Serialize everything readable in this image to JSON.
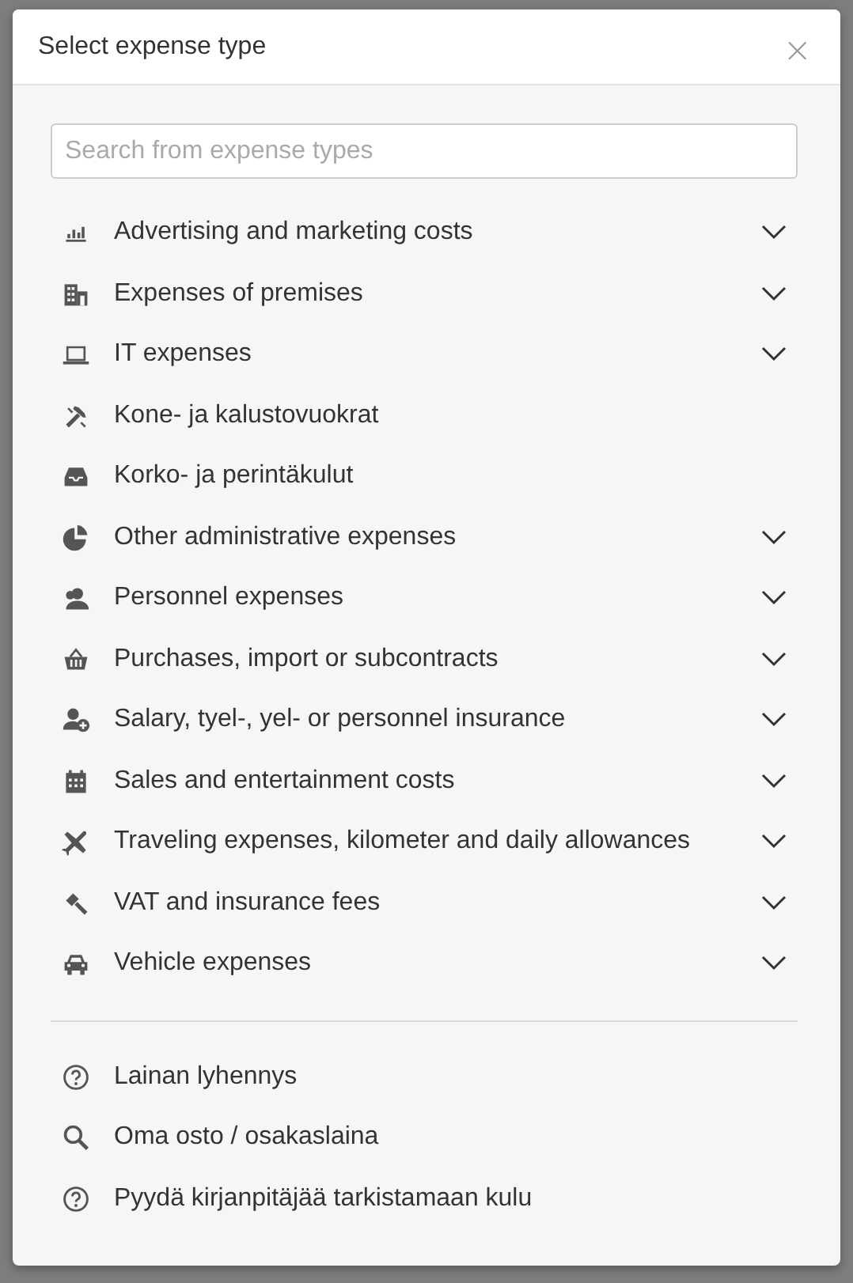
{
  "dialog": {
    "title": "Select expense type",
    "close": "×",
    "search": {
      "placeholder": "Search from expense types"
    },
    "categories": [
      {
        "label": "Advertising and marketing costs",
        "expandable": true
      },
      {
        "label": "Expenses of premises",
        "expandable": true
      },
      {
        "label": "IT expenses",
        "expandable": true
      },
      {
        "label": "Kone- ja kalustovuokrat",
        "expandable": false
      },
      {
        "label": "Korko- ja perintäkulut",
        "expandable": false
      },
      {
        "label": "Other administrative expenses",
        "expandable": true
      },
      {
        "label": "Personnel expenses",
        "expandable": true
      },
      {
        "label": "Purchases, import or subcontracts",
        "expandable": true
      },
      {
        "label": "Salary, tyel-, yel- or personnel insurance",
        "expandable": true
      },
      {
        "label": "Sales and entertainment costs",
        "expandable": true
      },
      {
        "label": "Traveling expenses, kilometer and daily allowances",
        "expandable": true
      },
      {
        "label": "VAT and insurance fees",
        "expandable": true
      },
      {
        "label": "Vehicle expenses",
        "expandable": true
      }
    ],
    "other_items": [
      {
        "label": "Lainan lyhennys"
      },
      {
        "label": "Oma osto / osakaslaina"
      },
      {
        "label": "Pyydä kirjanpitäjää tarkistamaan kulu"
      }
    ]
  }
}
